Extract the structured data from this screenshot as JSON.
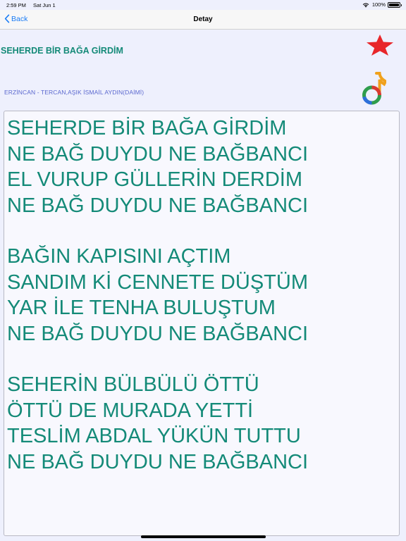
{
  "status_bar": {
    "time": "2:59 PM",
    "date": "Sat Jun 1",
    "battery": "100%",
    "battery_level": 1.0,
    "icons": [
      "wifi-icon",
      "battery-icon"
    ]
  },
  "nav": {
    "back_label": "Back",
    "title": "Detay",
    "accent_color": "#1a7cf5"
  },
  "song": {
    "title": "SEHERDE BİR BAĞA GİRDİM",
    "meta": "ERZİNCAN - TERCAN,AŞIK İSMAİL AYDIN(DAİMİ)",
    "text_color": "#148a78",
    "meta_color": "#5b68cf"
  },
  "actions": {
    "favorite_icon": "star-icon",
    "favorite_color": "#e8262a",
    "music_icon": "music-note-icon"
  },
  "lyrics": {
    "stanzas": [
      [
        "SEHERDE BİR BAĞA GİRDİM",
        "NE BAĞ DUYDU NE BAĞBANCI",
        "EL VURUP GÜLLERİN DERDİM",
        "NE BAĞ DUYDU NE BAĞBANCI"
      ],
      [
        "BAĞIN KAPISINI AÇTIM",
        "SANDIM Kİ CENNETE DÜŞTÜM",
        "YAR İLE TENHA BULUŞTUM",
        "NE BAĞ DUYDU NE BAĞBANCI"
      ],
      [
        "SEHERİN BÜLBÜLÜ ÖTTÜ",
        "ÖTTÜ DE MURADA YETTİ",
        "TESLİM ABDAL YÜKÜN TUTTU",
        "NE BAĞ DUYDU NE BAĞBANCI"
      ]
    ]
  }
}
